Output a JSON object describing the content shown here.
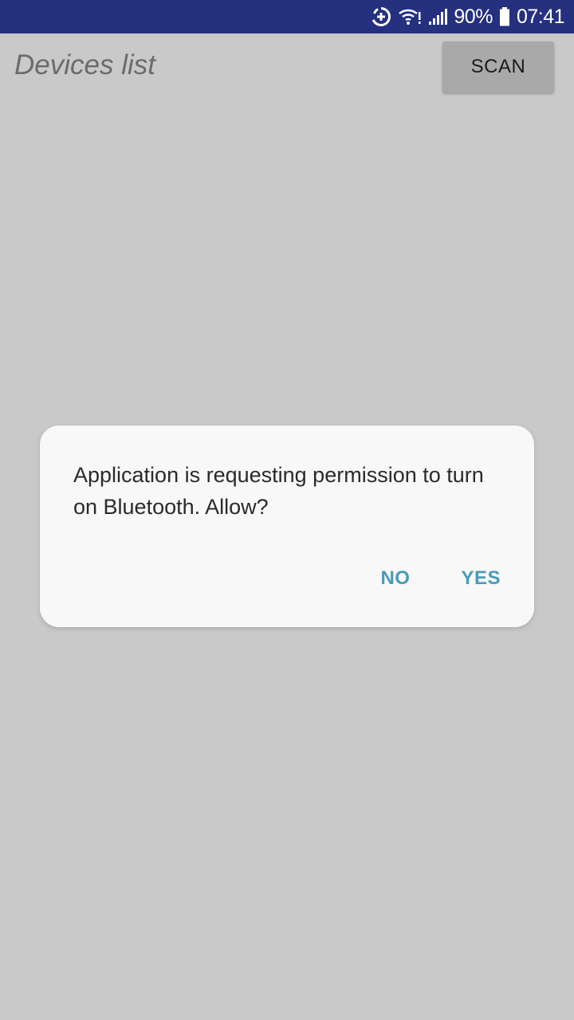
{
  "status_bar": {
    "battery_percent": "90%",
    "time": "07:41",
    "icons": [
      "data-saver-icon",
      "wifi-icon",
      "signal-icon",
      "battery-icon"
    ],
    "background_color": "#25307f"
  },
  "app_bar": {
    "title": "Devices list",
    "scan_label": "SCAN"
  },
  "dialog": {
    "message": "Application is requesting permission to turn on Bluetooth. Allow?",
    "no_label": "NO",
    "yes_label": "YES",
    "accent_color": "#4a9bb8"
  }
}
